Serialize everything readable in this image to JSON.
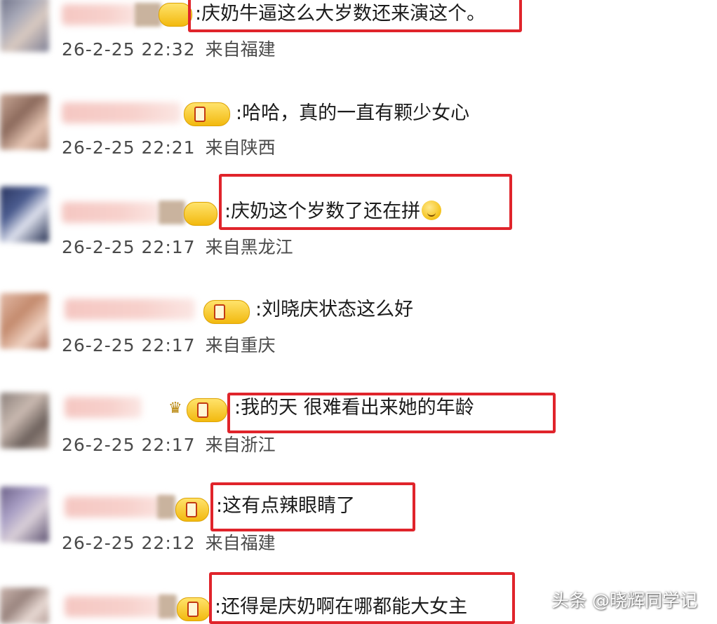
{
  "comments": [
    {
      "text": ":庆奶牛逼这么大岁数还来演这个。",
      "time": "26-2-25 22:32",
      "location": "来自福建",
      "highlighted": true,
      "badge": "none",
      "emoji": ""
    },
    {
      "text": ":哈哈，真的一直有颗少女心",
      "time": "26-2-25 22:21",
      "location": "来自陕西",
      "highlighted": false,
      "badge": "level",
      "emoji": ""
    },
    {
      "text": ":庆奶这个岁数了还在拼",
      "time": "26-2-25 22:17",
      "location": "来自黑龙江",
      "highlighted": true,
      "badge": "none",
      "emoji": "sweat-smile-emoji-icon"
    },
    {
      "text": ":刘晓庆状态这么好",
      "time": "26-2-25 22:17",
      "location": "来自重庆",
      "highlighted": false,
      "badge": "level",
      "emoji": ""
    },
    {
      "text": ":我的天 很难看出来她的年龄",
      "time": "26-2-25 22:17",
      "location": "来自浙江",
      "highlighted": true,
      "badge": "crown-level",
      "emoji": ""
    },
    {
      "text": ":这有点辣眼睛了",
      "time": "26-2-25 22:12",
      "location": "来自福建",
      "highlighted": true,
      "badge": "level",
      "emoji": ""
    },
    {
      "text": ":还得是庆奶啊在哪都能大女主",
      "time": "",
      "location": "",
      "highlighted": true,
      "badge": "level",
      "emoji": ""
    }
  ],
  "watermark": "头条 @晓辉同学记",
  "colors": {
    "highlight": "#e0242b",
    "badge_gold": "#f2b90f",
    "meta_text": "#4a4a4a"
  }
}
